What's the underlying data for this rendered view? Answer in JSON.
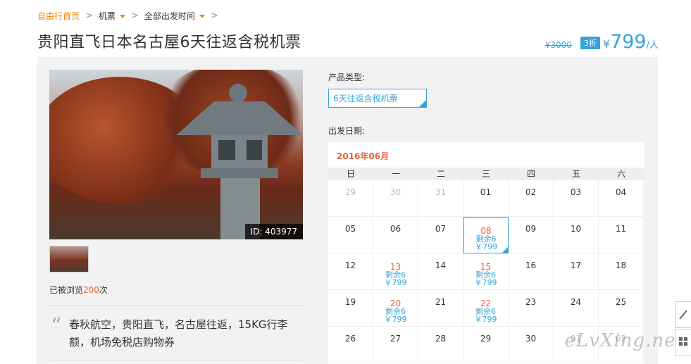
{
  "breadcrumb": {
    "home": "自由行首页",
    "sep": ">",
    "cat": "机票",
    "filter": "全部出发时间"
  },
  "title": "贵阳直飞日本名古屋6天往返含税机票",
  "price": {
    "old": "¥3000",
    "discount": "3折",
    "currency": "¥",
    "amount": "799",
    "unit": "/人"
  },
  "gallery": {
    "image_id": "ID: 403977"
  },
  "views": {
    "prefix": "已被浏览",
    "count": "200",
    "suffix": "次"
  },
  "description": "春秋航空，贵阳直飞，名古屋往返，15KG行李额，机场免税店购物券",
  "product_type": {
    "label": "产品类型:",
    "value": "6天往返含税机票"
  },
  "departure": {
    "label": "出发日期:"
  },
  "calendar": {
    "month": "2016年06月",
    "weekdays": [
      "日",
      "一",
      "二",
      "三",
      "四",
      "五",
      "六"
    ],
    "weeks": [
      [
        {
          "d": "29",
          "off": true
        },
        {
          "d": "30",
          "off": true
        },
        {
          "d": "31",
          "off": true
        },
        {
          "d": "01"
        },
        {
          "d": "02"
        },
        {
          "d": "03"
        },
        {
          "d": "04"
        }
      ],
      [
        {
          "d": "05"
        },
        {
          "d": "06"
        },
        {
          "d": "07"
        },
        {
          "d": "08",
          "s": "剩余6",
          "p": "￥799",
          "sel": true
        },
        {
          "d": "09"
        },
        {
          "d": "10"
        },
        {
          "d": "11"
        }
      ],
      [
        {
          "d": "12"
        },
        {
          "d": "13",
          "s": "剩余6",
          "p": "￥799"
        },
        {
          "d": "14"
        },
        {
          "d": "15",
          "s": "剩余6",
          "p": "￥799"
        },
        {
          "d": "16"
        },
        {
          "d": "17"
        },
        {
          "d": "18"
        }
      ],
      [
        {
          "d": "19"
        },
        {
          "d": "20",
          "s": "剩余6",
          "p": "￥799"
        },
        {
          "d": "21"
        },
        {
          "d": "22",
          "s": "剩余6",
          "p": "￥799"
        },
        {
          "d": "23"
        },
        {
          "d": "24"
        },
        {
          "d": "25"
        }
      ],
      [
        {
          "d": "26"
        },
        {
          "d": "27"
        },
        {
          "d": "28"
        },
        {
          "d": "29"
        },
        {
          "d": "30"
        },
        {
          "d": "01",
          "off": true
        },
        {
          "d": "02",
          "off": true
        }
      ]
    ]
  },
  "watermark": "eLvXing.net"
}
